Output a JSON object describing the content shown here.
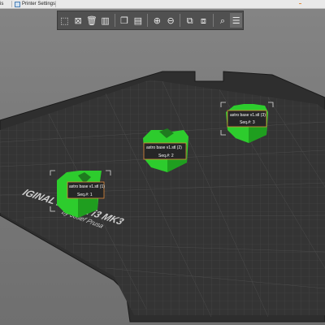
{
  "tabs": {
    "first_label": "is",
    "printer_settings": "Printer Settings"
  },
  "toolbar": {
    "buttons": [
      {
        "icon": "add-icon"
      },
      {
        "icon": "delete-icon"
      },
      {
        "icon": "delete-all-icon"
      },
      {
        "icon": "arrange-icon"
      },
      {
        "icon": "copy-icon"
      },
      {
        "icon": "paste-icon"
      },
      {
        "icon": "add-instance-icon"
      },
      {
        "icon": "remove-instance-icon"
      },
      {
        "icon": "split-objects-icon"
      },
      {
        "icon": "split-parts-icon"
      },
      {
        "icon": "search-icon"
      },
      {
        "icon": "layers-icon"
      }
    ]
  },
  "bed": {
    "brand_text": "IGINAL PRUSA i3 MK3",
    "byline_text": "by Josef Prusa"
  },
  "objects": [
    {
      "name": "astro base v1.stl (1)",
      "seq": "Seq.#: 1"
    },
    {
      "name": "astro base v1.stl (2)",
      "seq": "Seq.#: 2"
    },
    {
      "name": "astro base v1.stl (3)",
      "seq": "Seq.#: 3"
    }
  ],
  "colors": {
    "object_green": "#2dcc2d",
    "bed_dark": "#2b2b2b",
    "label_border": "#e08a3c"
  }
}
